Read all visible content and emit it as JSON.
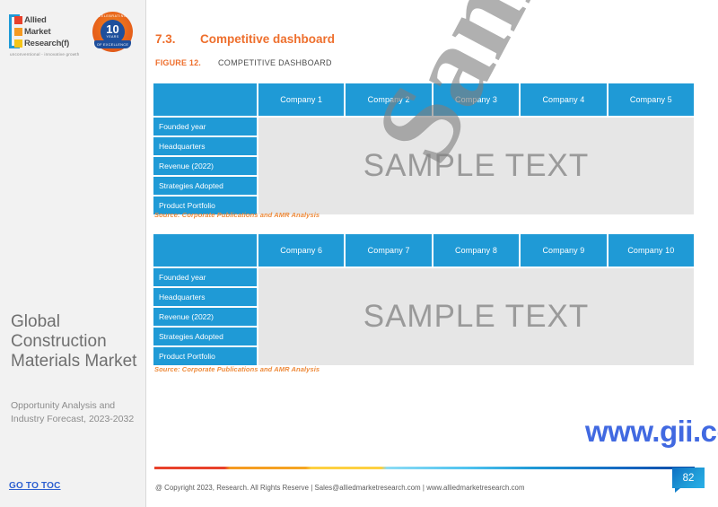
{
  "sidebar": {
    "logo": {
      "line1": "Allied",
      "line2": "Market",
      "line3": "Research(f)",
      "tagline": "unconventional  -  innovative growth"
    },
    "badge": {
      "top_text": "CELEBRATING",
      "number": "10",
      "years_label": "YEARS",
      "ribbon": "OF EXCELLENCE"
    },
    "report_title": "Global Construction Materials Market",
    "report_subtitle": "Opportunity Analysis and Industry Forecast, 2023-2032",
    "toc_link": "GO TO TOC"
  },
  "content": {
    "section_number": "7.3.",
    "section_title": "Competitive dashboard",
    "figure_number": "FIGURE 12.",
    "figure_title": "COMPETITIVE DASHBOARD",
    "sample_text": "SAMPLE TEXT",
    "row_labels": [
      "Founded year",
      "Headquarters",
      "Revenue (2022)",
      "Strategies Adopted",
      "Product Portfolio"
    ],
    "table1": {
      "corner_header": "",
      "columns": [
        "Company 1",
        "Company 2",
        "Company 3",
        "Company 4",
        "Company 5"
      ],
      "source": "Source: Corporate Publications and AMR Analysis"
    },
    "table2": {
      "corner_header": "",
      "columns": [
        "Company 6",
        "Company 7",
        "Company 8",
        "Company 9",
        "Company 10"
      ],
      "source": "Source: Corporate Publications and AMR Analysis"
    }
  },
  "watermarks": {
    "diagonal": "Sample",
    "site": "www.gii.co.jp"
  },
  "footer": {
    "copyright": "@ Copyright 2023, Research. All Rights Reserve | Sales@alliedmarketresearch.com | www.alliedmarketresearch.com",
    "page_number": "82"
  },
  "colors": {
    "accent_orange": "#ee6f2d",
    "table_blue": "#1f9ad6",
    "body_gray": "#e6e6e6",
    "sidebar_bg": "#f2f2f2",
    "link_blue": "#2c5fd0",
    "watermark_blue": "#4169e1"
  }
}
